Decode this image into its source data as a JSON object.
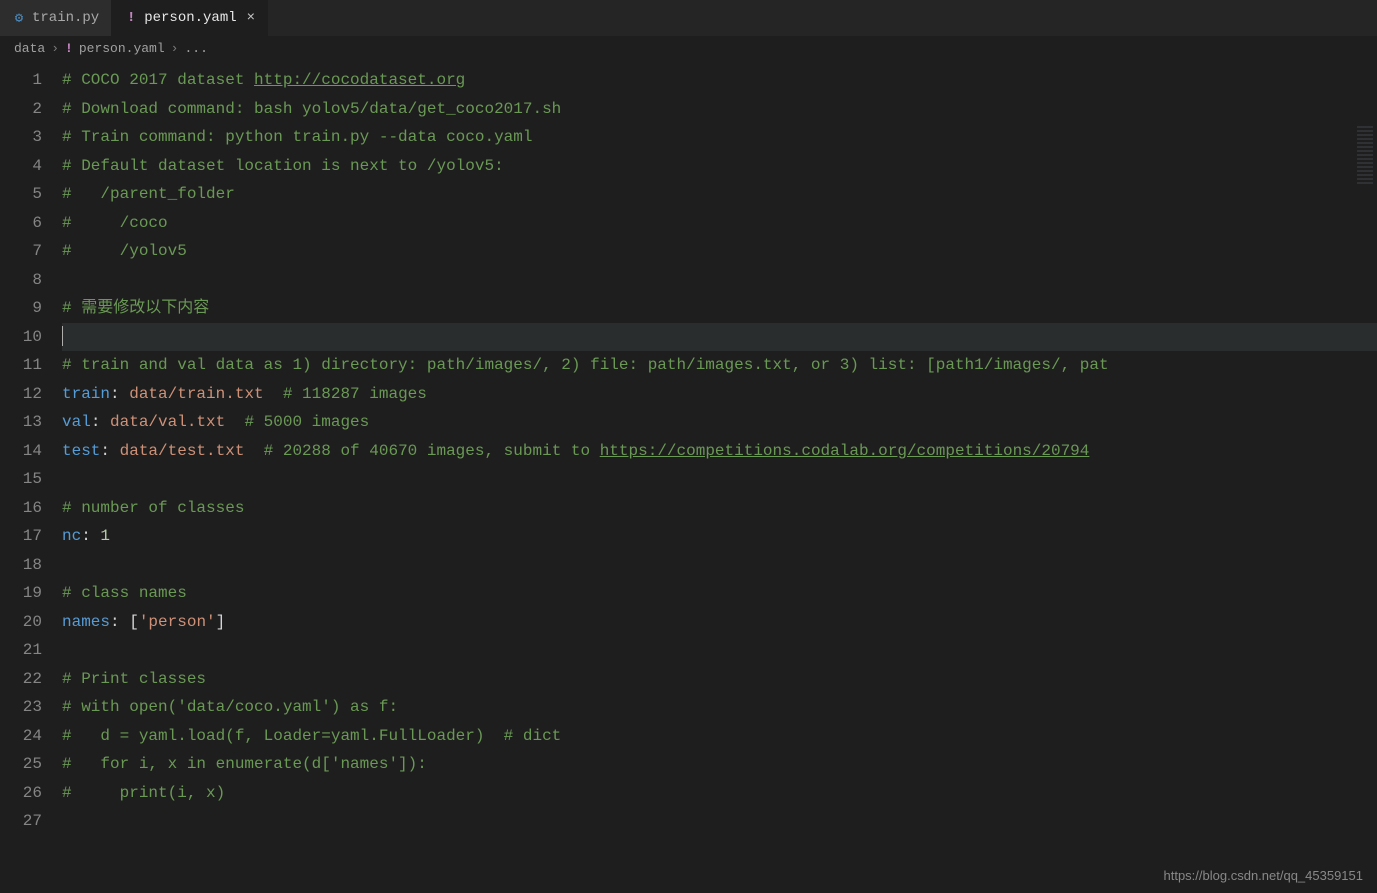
{
  "tabs": [
    {
      "label": "train.py",
      "icon": "py",
      "active": false
    },
    {
      "label": "person.yaml",
      "icon": "yaml",
      "active": true
    }
  ],
  "breadcrumb": {
    "folder": "data",
    "file": "person.yaml",
    "more": "..."
  },
  "code": {
    "lines": [
      [
        {
          "t": "# COCO 2017 dataset ",
          "c": "c-comment"
        },
        {
          "t": "http://cocodataset.org",
          "c": "c-link"
        }
      ],
      [
        {
          "t": "# Download command: bash yolov5/data/get_coco2017.sh",
          "c": "c-comment"
        }
      ],
      [
        {
          "t": "# Train command: python train.py --data coco.yaml",
          "c": "c-comment"
        }
      ],
      [
        {
          "t": "# Default dataset location is next to /yolov5:",
          "c": "c-comment"
        }
      ],
      [
        {
          "t": "#   /parent_folder",
          "c": "c-comment"
        }
      ],
      [
        {
          "t": "#     /coco",
          "c": "c-comment"
        }
      ],
      [
        {
          "t": "#     /yolov5",
          "c": "c-comment"
        }
      ],
      [],
      [
        {
          "t": "# 需要修改以下内容",
          "c": "c-comment"
        }
      ],
      [
        {
          "t": "",
          "c": "cursor-line"
        }
      ],
      [
        {
          "t": "# train and val data as 1) directory: path/images/, 2) file: path/images.txt, or 3) list: [path1/images/, pat",
          "c": "c-comment"
        }
      ],
      [
        {
          "t": "train",
          "c": "c-key"
        },
        {
          "t": ": ",
          "c": "c-punct"
        },
        {
          "t": "data/train.txt",
          "c": "c-val"
        },
        {
          "t": "  ",
          "c": "c-punct"
        },
        {
          "t": "# 118287 images",
          "c": "c-comment"
        }
      ],
      [
        {
          "t": "val",
          "c": "c-key"
        },
        {
          "t": ": ",
          "c": "c-punct"
        },
        {
          "t": "data/val.txt",
          "c": "c-val"
        },
        {
          "t": "  ",
          "c": "c-punct"
        },
        {
          "t": "# 5000 images",
          "c": "c-comment"
        }
      ],
      [
        {
          "t": "test",
          "c": "c-key"
        },
        {
          "t": ": ",
          "c": "c-punct"
        },
        {
          "t": "data/test.txt",
          "c": "c-val"
        },
        {
          "t": "  ",
          "c": "c-punct"
        },
        {
          "t": "# 20288 of 40670 images, submit to ",
          "c": "c-comment"
        },
        {
          "t": "https://competitions.codalab.org/competitions/20794",
          "c": "c-link"
        }
      ],
      [],
      [
        {
          "t": "# number of classes",
          "c": "c-comment"
        }
      ],
      [
        {
          "t": "nc",
          "c": "c-key"
        },
        {
          "t": ": ",
          "c": "c-punct"
        },
        {
          "t": "1",
          "c": "c-num"
        }
      ],
      [],
      [
        {
          "t": "# class names",
          "c": "c-comment"
        }
      ],
      [
        {
          "t": "names",
          "c": "c-key"
        },
        {
          "t": ": [",
          "c": "c-punct"
        },
        {
          "t": "'person'",
          "c": "c-val"
        },
        {
          "t": "]",
          "c": "c-punct"
        }
      ],
      [],
      [
        {
          "t": "# Print classes",
          "c": "c-comment"
        }
      ],
      [
        {
          "t": "# with open('data/coco.yaml') as f:",
          "c": "c-comment"
        }
      ],
      [
        {
          "t": "#   d = yaml.load(f, Loader=yaml.FullLoader)  # dict",
          "c": "c-comment"
        }
      ],
      [
        {
          "t": "#   for i, x in enumerate(d['names']):",
          "c": "c-comment"
        }
      ],
      [
        {
          "t": "#     print(i, x)",
          "c": "c-comment"
        }
      ],
      []
    ],
    "current_line_index": 9
  },
  "watermark": "https://blog.csdn.net/qq_45359151"
}
